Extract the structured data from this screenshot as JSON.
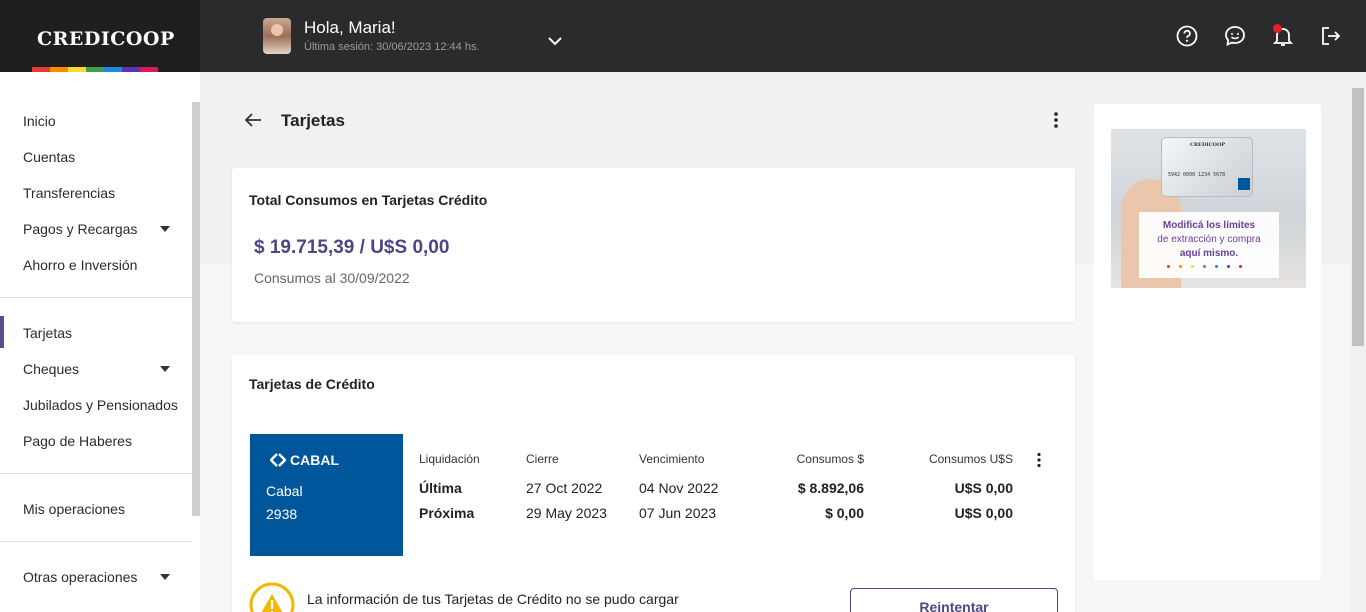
{
  "brand": {
    "logo": "CREDICOOP",
    "stripe_colors": [
      "#e53935",
      "#fb8c00",
      "#fdd835",
      "#43a047",
      "#1e88e5",
      "#5e35b1",
      "#d81b60"
    ]
  },
  "header": {
    "greeting": "Hola, Maria!",
    "last_session": "Última sesión: 30/06/2023 12:44 hs.",
    "icons": [
      "help-icon",
      "chat-icon",
      "bell-icon",
      "logout-icon"
    ]
  },
  "sidebar": {
    "items": [
      {
        "label": "Inicio"
      },
      {
        "label": "Cuentas"
      },
      {
        "label": "Transferencias"
      },
      {
        "label": "Pagos y Recargas"
      },
      {
        "label": "Ahorro e Inversión"
      },
      {
        "label": "Tarjetas"
      },
      {
        "label": "Cheques"
      },
      {
        "label": "Jubilados y Pensionados"
      },
      {
        "label": "Pago de Haberes"
      },
      {
        "label": "Mis operaciones"
      },
      {
        "label": "Otras operaciones"
      }
    ],
    "active": "Tarjetas"
  },
  "page": {
    "title": "Tarjetas"
  },
  "totals": {
    "title": "Total Consumos en Tarjetas Crédito",
    "amount": "$ 19.715,39  / U$S 0,00",
    "date": "Consumos al 30/09/2022"
  },
  "credit_cards": {
    "title": "Tarjetas de Crédito",
    "card": {
      "brand": "CABAL",
      "name": "Cabal",
      "number": "2938",
      "color": "#00569b"
    },
    "headers": {
      "liquidacion": "Liquidación",
      "cierre": "Cierre",
      "vencimiento": "Vencimiento",
      "consumos_ars": "Consumos $",
      "consumos_usd": "Consumos U$S"
    },
    "rows": [
      {
        "liquidacion": "Última",
        "cierre": "27 Oct 2022",
        "vencimiento": "04 Nov 2022",
        "consumos_ars": "$ 8.892,06",
        "consumos_usd": "U$S 0,00"
      },
      {
        "liquidacion": "Próxima",
        "cierre": "29 May 2023",
        "vencimiento": "07 Jun 2023",
        "consumos_ars": "$ 0,00",
        "consumos_usd": "U$S 0,00"
      }
    ],
    "warning": "La información de tus Tarjetas de Crédito no se pudo cargar correctamente. Por favor volvé a intentarlo.",
    "retry_label": "Reintentar"
  },
  "promo": {
    "card_brand": "CREDICOOP",
    "card_number": "5942  0000  1234  5678",
    "line1": "Modificá los límites",
    "line2": "de extracción y compra",
    "line3": "aquí mismo."
  },
  "colors": {
    "accent": "#4e4585",
    "topbar": "#2b2b2d",
    "warning": "#f2b600"
  }
}
